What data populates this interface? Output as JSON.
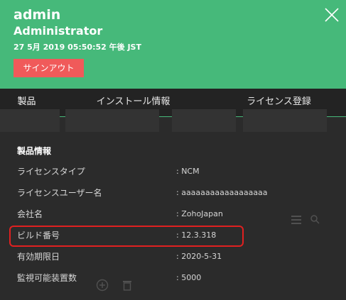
{
  "header": {
    "user_name": "admin",
    "user_role": "Administrator",
    "timestamp": "27 5月 2019 05:50:52 午後 JST",
    "signout_label": "サインアウト",
    "close_icon": "close-icon",
    "accent_color": "#46b97a",
    "signout_color": "#f05a5a"
  },
  "tabs": [
    {
      "label": "製品",
      "active": true
    },
    {
      "label": "インストール情報",
      "active": false
    },
    {
      "label": "ライセンス登録",
      "active": false
    }
  ],
  "product_info": {
    "title": "製品情報",
    "rows": [
      {
        "label": "ライセンスタイプ",
        "value": ": NCM"
      },
      {
        "label": "ライセンスユーザー名",
        "value": ": aaaaaaaaaaaaaaaaaa"
      },
      {
        "label": "会社名",
        "value": ": ZohoJapan"
      },
      {
        "label": "ビルド番号",
        "value": ": 12.3.318",
        "highlighted": true
      },
      {
        "label": "有効期限日",
        "value": ": 2020-5-31"
      },
      {
        "label": "監視可能装置数",
        "value": ": 5000"
      }
    ]
  },
  "highlight_color": "#e02020"
}
